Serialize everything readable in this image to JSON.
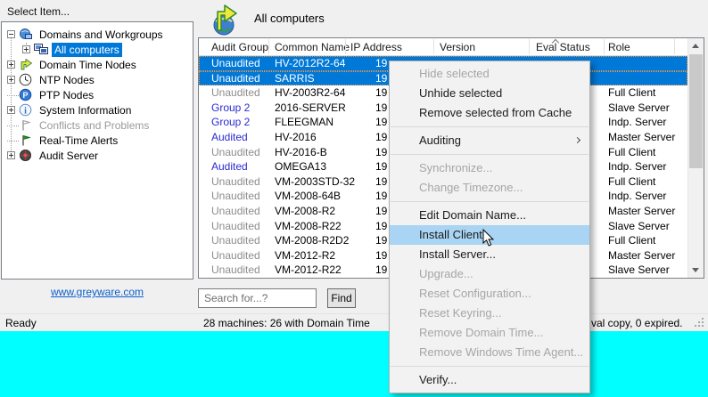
{
  "colors": {
    "selection_blue": "#0078d7",
    "menu_highlight": "#a9d4f3",
    "desktop_cyan": "#00ffff",
    "link_blue": "#0b5fcb",
    "audit_blue": "#2a2ad0",
    "muted_gray": "#8c8c8c"
  },
  "left_panel": {
    "label": "Select Item...",
    "link": "www.greyware.com",
    "tree": [
      {
        "label": "Domains and Workgroups",
        "icon": "domains-icon",
        "expand": "minus",
        "level": 0
      },
      {
        "label": "All computers",
        "icon": "computers-icon",
        "expand": "plus",
        "level": 1,
        "selected": true
      },
      {
        "label": "Domain Time Nodes",
        "icon": "domain-time-arrow-icon",
        "expand": "plus",
        "level": 0
      },
      {
        "label": "NTP Nodes",
        "icon": "clock-icon",
        "expand": "plus",
        "level": 0
      },
      {
        "label": "PTP Nodes",
        "icon": "ptp-icon",
        "expand": "none",
        "level": 0
      },
      {
        "label": "System Information",
        "icon": "info-icon",
        "expand": "plus",
        "level": 0
      },
      {
        "label": "Conflicts and Problems",
        "icon": "gray-flag-icon",
        "expand": "none",
        "level": 0,
        "muted": true
      },
      {
        "label": "Real-Time Alerts",
        "icon": "green-flag-icon",
        "expand": "none",
        "level": 0
      },
      {
        "label": "Audit Server",
        "icon": "audit-server-icon",
        "expand": "plus",
        "level": 0
      }
    ]
  },
  "main": {
    "title": "All computers",
    "columns": [
      "Audit Group",
      "Common Name",
      "IP Address",
      "Version",
      "Eval Status",
      "Role"
    ],
    "sorted_column": "Eval Status",
    "rows": [
      {
        "audit": "Unaudited",
        "name": "HV-2012R2-64",
        "ip": "19",
        "role": "",
        "selected": true,
        "audit_style": "selected"
      },
      {
        "audit": "Unaudited",
        "name": "SARRIS",
        "ip": "19",
        "role": "",
        "selected": true,
        "audit_style": "selected"
      },
      {
        "audit": "Unaudited",
        "name": "HV-2003R2-64",
        "ip": "19",
        "role": "Full Client",
        "audit_style": "muted"
      },
      {
        "audit": "Group 2",
        "name": "2016-SERVER",
        "ip": "19",
        "role": "Slave Server",
        "audit_style": "blue"
      },
      {
        "audit": "Group 2",
        "name": "FLEEGMAN",
        "ip": "19",
        "role": "Indp. Server",
        "audit_style": "blue"
      },
      {
        "audit": "Audited",
        "name": "HV-2016",
        "ip": "19",
        "role": "Master Server",
        "audit_style": "blue"
      },
      {
        "audit": "Unaudited",
        "name": "HV-2016-B",
        "ip": "19",
        "role": "Full Client",
        "audit_style": "muted"
      },
      {
        "audit": "Audited",
        "name": "OMEGA13",
        "ip": "19",
        "role": "Indp. Server",
        "audit_style": "blue"
      },
      {
        "audit": "Unaudited",
        "name": "VM-2003STD-32",
        "ip": "19",
        "role": "Full Client",
        "audit_style": "muted"
      },
      {
        "audit": "Unaudited",
        "name": "VM-2008-64B",
        "ip": "19",
        "role": "Indp. Server",
        "audit_style": "muted"
      },
      {
        "audit": "Unaudited",
        "name": "VM-2008-R2",
        "ip": "19",
        "role": "Master Server",
        "audit_style": "muted"
      },
      {
        "audit": "Unaudited",
        "name": "VM-2008-R22",
        "ip": "19",
        "role": "Slave Server",
        "audit_style": "muted"
      },
      {
        "audit": "Unaudited",
        "name": "VM-2008-R2D2",
        "ip": "19",
        "role": "Full Client",
        "audit_style": "muted"
      },
      {
        "audit": "Unaudited",
        "name": "VM-2012-R2",
        "ip": "19",
        "role": "Master Server",
        "audit_style": "muted"
      },
      {
        "audit": "Unaudited",
        "name": "VM-2012-R22",
        "ip": "19",
        "role": "Slave Server",
        "audit_style": "muted"
      }
    ],
    "search": {
      "placeholder": "Search for...?",
      "find_label": "Find"
    }
  },
  "status_bar": {
    "left": "Ready",
    "machines": "28 machines: 26 with Domain Time",
    "machines_right": "val copy, 0 expired."
  },
  "context_menu": {
    "items": [
      {
        "label": "Hide selected",
        "disabled": true
      },
      {
        "label": "Unhide selected"
      },
      {
        "label": "Remove selected from Cache"
      },
      {
        "separator": true
      },
      {
        "label": "Auditing",
        "submenu": true
      },
      {
        "separator": true
      },
      {
        "label": "Synchronize...",
        "disabled": true
      },
      {
        "label": "Change Timezone...",
        "disabled": true
      },
      {
        "separator": true
      },
      {
        "label": "Edit Domain Name..."
      },
      {
        "label": "Install Client...",
        "highlighted": true
      },
      {
        "label": "Install Server..."
      },
      {
        "label": "Upgrade...",
        "disabled": true
      },
      {
        "label": "Reset Configuration...",
        "disabled": true
      },
      {
        "label": "Reset Keyring...",
        "disabled": true
      },
      {
        "label": "Remove Domain Time...",
        "disabled": true
      },
      {
        "label": "Remove Windows Time Agent...",
        "disabled": true
      },
      {
        "separator": true
      },
      {
        "label": "Verify..."
      }
    ]
  }
}
